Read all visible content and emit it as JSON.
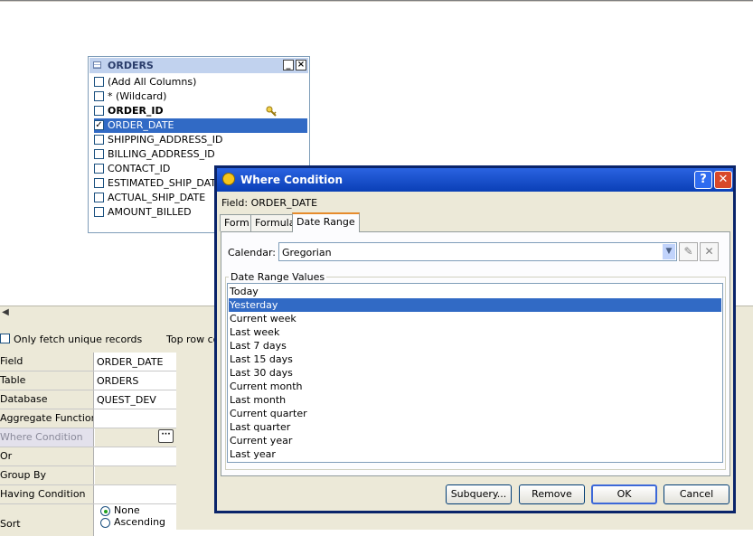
{
  "orders_window": {
    "title": "ORDERS",
    "min_glyph": "_",
    "close_glyph": "×",
    "columns": [
      {
        "label": "(Add All Columns)",
        "checked": false,
        "bold": false
      },
      {
        "label": "* (Wildcard)",
        "checked": false,
        "bold": false
      },
      {
        "label": "ORDER_ID",
        "checked": false,
        "bold": true
      },
      {
        "label": "ORDER_DATE",
        "checked": true,
        "bold": false,
        "selected": true
      },
      {
        "label": "SHIPPING_ADDRESS_ID",
        "checked": false,
        "bold": false
      },
      {
        "label": "BILLING_ADDRESS_ID",
        "checked": false,
        "bold": false
      },
      {
        "label": "CONTACT_ID",
        "checked": false,
        "bold": false
      },
      {
        "label": "ESTIMATED_SHIP_DATE",
        "checked": false,
        "bold": false
      },
      {
        "label": "ACTUAL_SHIP_DATE",
        "checked": false,
        "bold": false
      },
      {
        "label": "AMOUNT_BILLED",
        "checked": false,
        "bold": false
      }
    ]
  },
  "options": {
    "unique_label": "Only fetch unique records",
    "top_row_label": "Top row co"
  },
  "properties": {
    "header_key": "Field",
    "header_value": "ORDER_DATE",
    "rows": [
      {
        "key": "Table",
        "value": "ORDERS"
      },
      {
        "key": "Database",
        "value": "QUEST_DEV"
      },
      {
        "key": "Aggregate Function",
        "value": ""
      },
      {
        "key": "Where Condition",
        "value": ""
      },
      {
        "key": "Or",
        "value": ""
      },
      {
        "key": "Group By",
        "value": ""
      },
      {
        "key": "Having Condition",
        "value": ""
      },
      {
        "key": "Sort",
        "value": ""
      }
    ],
    "sort_options": [
      "None",
      "Ascending"
    ],
    "ellipsis": "···"
  },
  "dialog": {
    "title": "Where Condition",
    "help_glyph": "?",
    "close_glyph": "✕",
    "field_label": "Field: ORDER_DATE",
    "tabs": [
      "Form",
      "Formula",
      "Date Range"
    ],
    "active_tab": "Date Range",
    "calendar_label": "Calendar:",
    "calendar_value": "Gregorian",
    "group_label": "Date Range Values",
    "date_values": [
      "Today",
      "Yesterday",
      "Current week",
      "Last week",
      "Last 7 days",
      "Last 15 days",
      "Last 30 days",
      "Current month",
      "Last month",
      "Current quarter",
      "Last quarter",
      "Current year",
      "Last year"
    ],
    "selected_value": "Yesterday",
    "buttons": {
      "subquery": "Subquery...",
      "remove": "Remove",
      "ok": "OK",
      "cancel": "Cancel"
    }
  },
  "colors": {
    "selection": "#316ac5",
    "title_bar": "#0a3fb6",
    "orders_title": "#c1d2ee"
  }
}
